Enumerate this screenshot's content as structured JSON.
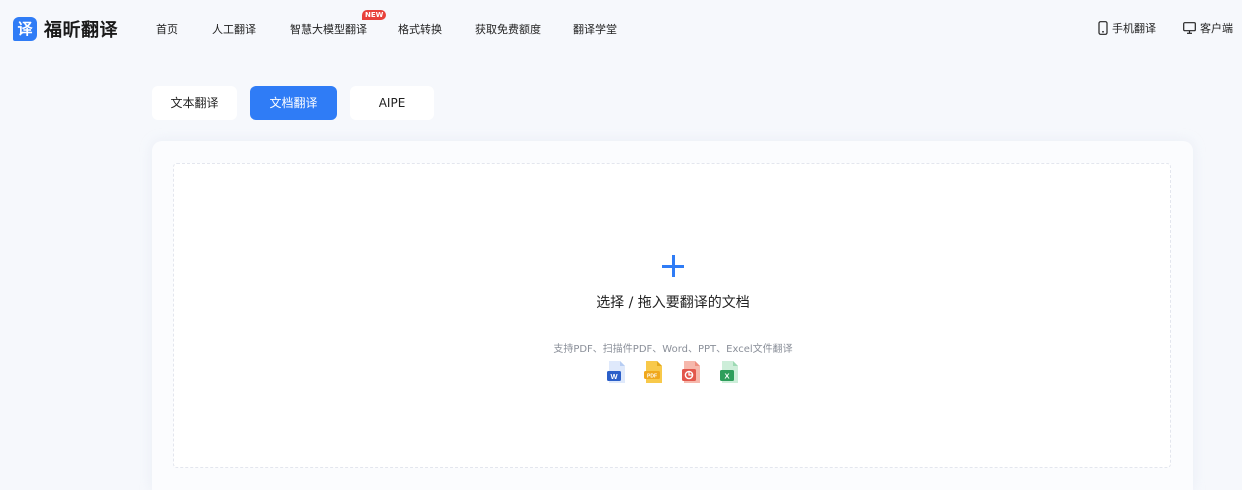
{
  "app": {
    "logo_glyph": "译",
    "name": "福昕翻译",
    "brand_color": "#2f7cf6"
  },
  "nav": {
    "items": [
      {
        "label": "首页"
      },
      {
        "label": "人工翻译"
      },
      {
        "label": "智慧大模型翻译",
        "badge": "NEW"
      },
      {
        "label": "格式转换"
      },
      {
        "label": "获取免费额度"
      },
      {
        "label": "翻译学堂"
      }
    ],
    "mobile": {
      "label": "手机翻译",
      "icon": "phone-icon"
    },
    "desktop": {
      "label": "客户端",
      "icon": "monitor-icon"
    }
  },
  "tabs": [
    {
      "label": "文本翻译",
      "active": false
    },
    {
      "label": "文档翻译",
      "active": true
    },
    {
      "label": "AIPE",
      "active": false
    }
  ],
  "upload": {
    "icon": "plus-icon",
    "title": "选择 / 拖入要翻译的文档",
    "hint": "支持PDF、扫描件PDF、Word、PPT、Excel文件翻译",
    "file_types": [
      {
        "name": "word-file-icon",
        "badge": "W",
        "color": "#2b5fc9"
      },
      {
        "name": "pdf-file-icon",
        "badge": "PDF",
        "color": "#f0b429"
      },
      {
        "name": "ppt-file-icon",
        "badge": "P",
        "color": "#e2574c"
      },
      {
        "name": "excel-file-icon",
        "badge": "X",
        "color": "#2e9e5b"
      }
    ]
  }
}
